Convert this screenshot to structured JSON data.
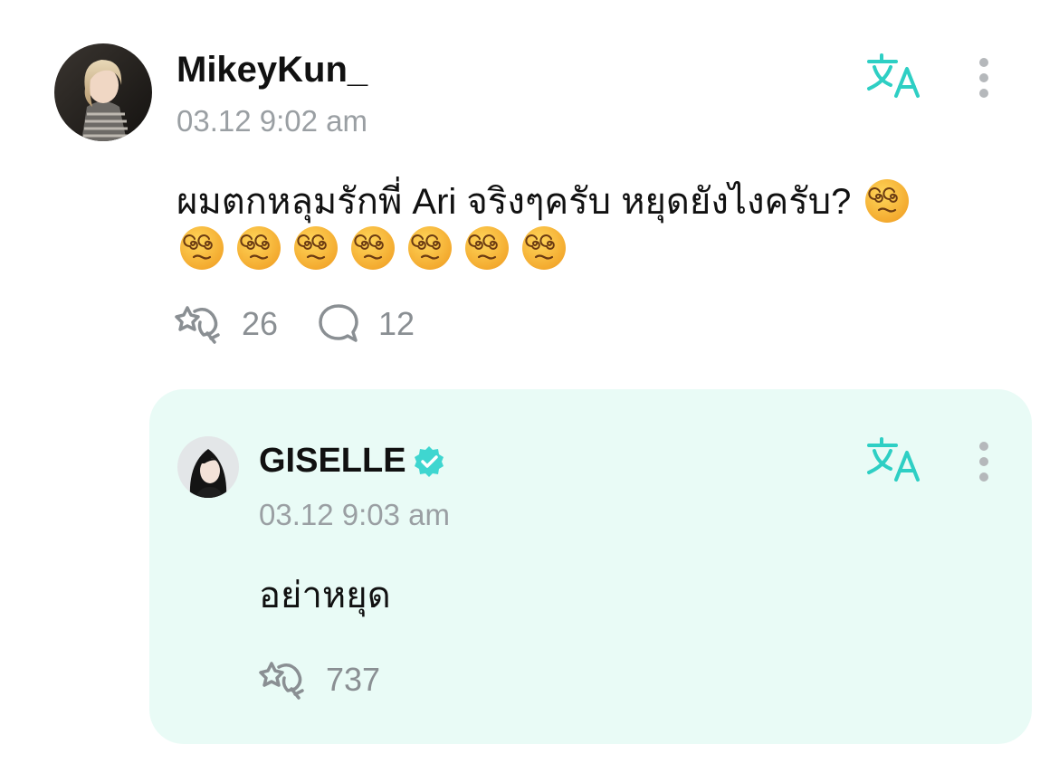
{
  "post": {
    "username": "MikeyKun_",
    "timestamp": "03.12 9:02 am",
    "text": "ผมตกหลุมรักพี่ Ari จริงๆครับ หยุดยังไงครับ?",
    "emoji": "face-with-spiral-eyes",
    "like_count": "26",
    "comment_count": "12"
  },
  "reply": {
    "username": "GISELLE",
    "verified": true,
    "timestamp": "03.12 9:03 am",
    "text": "อย่าหยุด",
    "like_count": "737"
  },
  "colors": {
    "accent": "#2ecfc4",
    "reply_bg": "#e9fbf6",
    "muted": "#9a9fa3",
    "emoji_face": "#f6b73c"
  }
}
